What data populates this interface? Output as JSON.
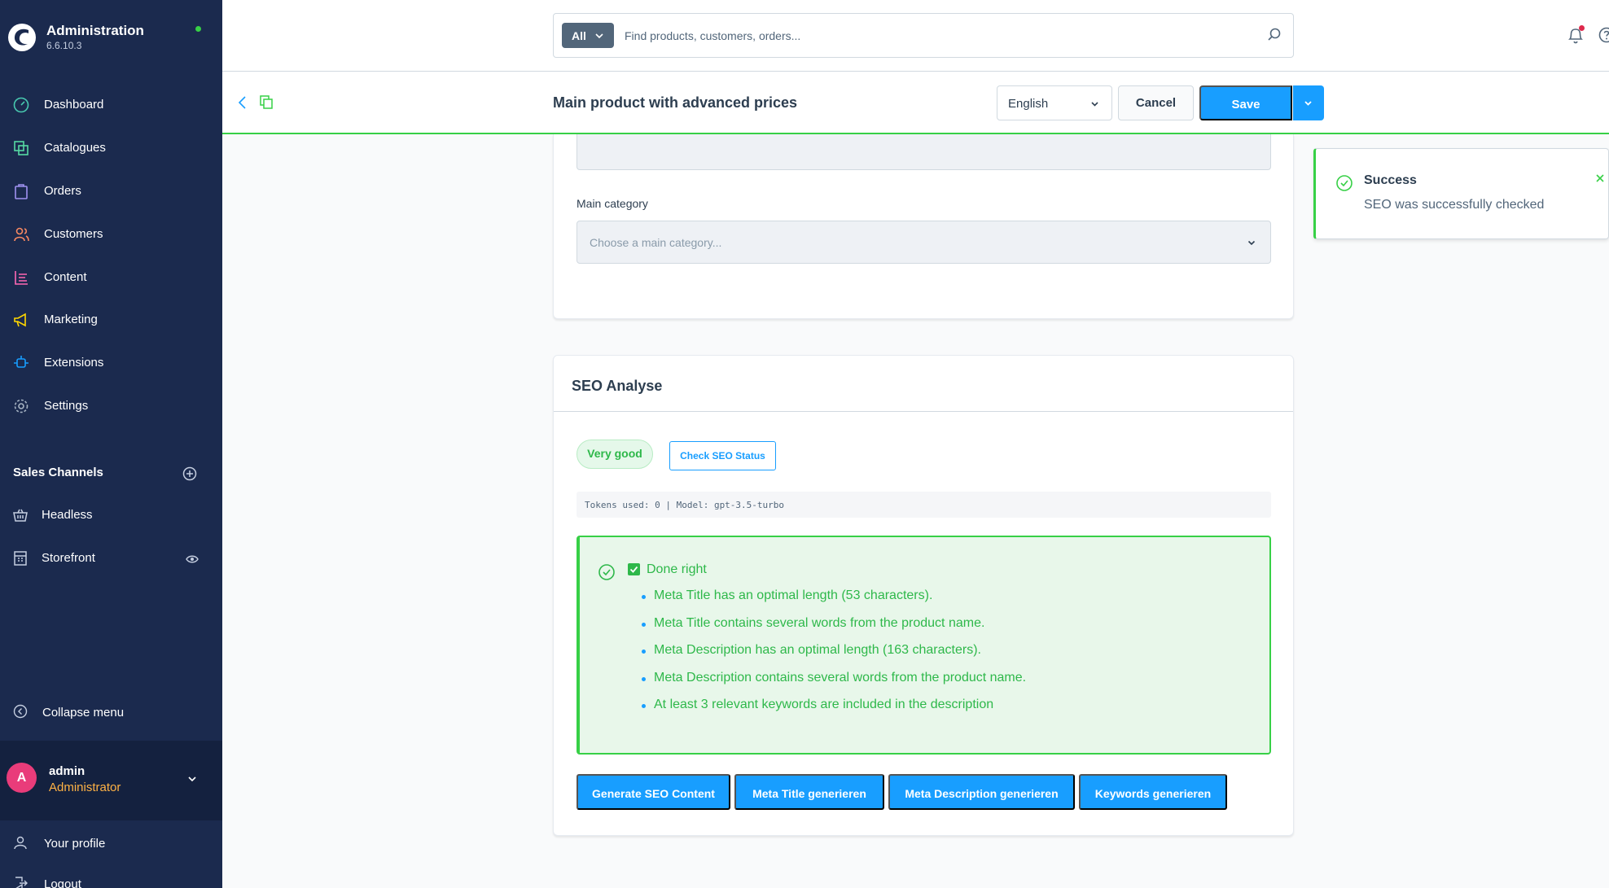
{
  "app": {
    "title": "Administration",
    "version": "6.6.10.3"
  },
  "nav": {
    "items": [
      {
        "label": "Dashboard",
        "icon": "dashboard-icon"
      },
      {
        "label": "Catalogues",
        "icon": "catalogue-icon"
      },
      {
        "label": "Orders",
        "icon": "orders-icon"
      },
      {
        "label": "Customers",
        "icon": "customers-icon"
      },
      {
        "label": "Content",
        "icon": "content-icon"
      },
      {
        "label": "Marketing",
        "icon": "marketing-icon"
      },
      {
        "label": "Extensions",
        "icon": "extensions-icon"
      },
      {
        "label": "Settings",
        "icon": "settings-icon"
      }
    ]
  },
  "sales_channels": {
    "title": "Sales Channels",
    "items": [
      {
        "label": "Headless",
        "icon": "basket-icon"
      },
      {
        "label": "Storefront",
        "icon": "storefront-icon"
      }
    ]
  },
  "collapse_label": "Collapse menu",
  "user": {
    "initial": "A",
    "name": "admin",
    "role": "Administrator",
    "profile_label": "Your profile",
    "logout_label": "Logout"
  },
  "search": {
    "type_label": "All",
    "placeholder": "Find products, customers, orders..."
  },
  "smartbar": {
    "title": "Main product with advanced prices",
    "language": "English",
    "cancel_label": "Cancel",
    "save_label": "Save"
  },
  "category": {
    "label": "Main category",
    "placeholder": "Choose a main category..."
  },
  "seo": {
    "title": "SEO Analyse",
    "rating": "Very good",
    "check_label": "Check SEO Status",
    "tokens_info": "Tokens used: 0 | Model: gpt-3.5-turbo",
    "result_heading": "Done right",
    "results": [
      "Meta Title has an optimal length (53 characters).",
      "Meta Title contains several words from the product name.",
      "Meta Description has an optimal length (163 characters).",
      "Meta Description contains several words from the product name.",
      "At least 3 relevant keywords are included in the description"
    ],
    "actions": [
      "Generate SEO Content",
      "Meta Title generieren",
      "Meta Description generieren",
      "Keywords generieren"
    ]
  },
  "toast": {
    "title": "Success",
    "message": "SEO was successfully checked"
  },
  "colors": {
    "sidebar_bg": "#1b2a4e",
    "primary": "#189eff",
    "success": "#37d046",
    "success_text": "#2eb84a",
    "role_accent": "#ffb245"
  }
}
